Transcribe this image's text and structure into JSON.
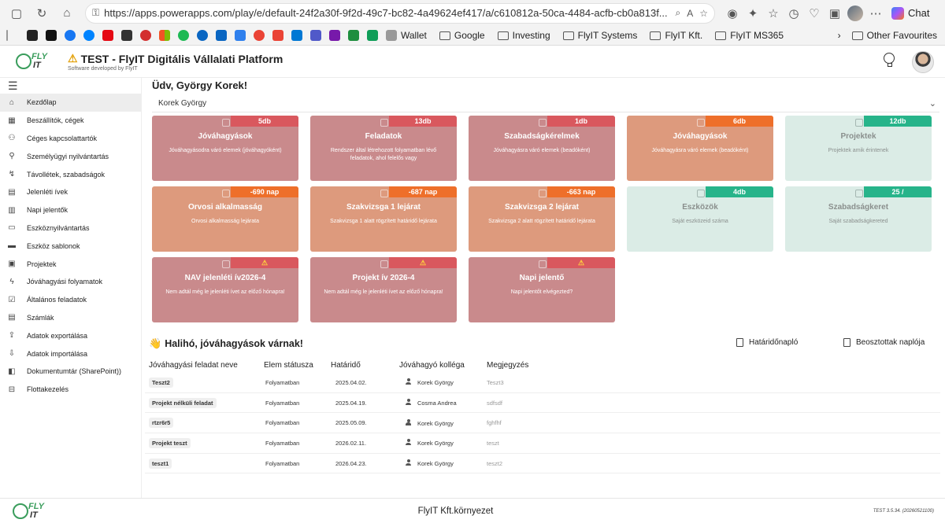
{
  "browser": {
    "url": "https://apps.powerapps.com/play/e/default-24f2a30f-9f2d-49c7-bc82-4a49624ef417/a/c610812a-50ca-4484-acfb-cb0a813f...",
    "chat_label": "Chat",
    "bookmarks": [
      "Wallet",
      "Google",
      "Investing",
      "FlyIT Systems",
      "FlyIT Kft.",
      "FlyIT MS365"
    ],
    "other_favourites": "Other Favourites"
  },
  "header": {
    "logo_top": "FLY",
    "logo_bottom": "IT",
    "title": "TEST - FlyIT Digitális Vállalati Platform",
    "subtitle": "Software developed by FlyIT"
  },
  "sidebar": {
    "items": [
      {
        "label": "Kezdőlap",
        "icon": "home-icon"
      },
      {
        "label": "Beszállítók, cégek",
        "icon": "building-icon"
      },
      {
        "label": "Céges kapcsolattartók",
        "icon": "contacts-icon"
      },
      {
        "label": "Személyügyi nyilvántartás",
        "icon": "person-icon"
      },
      {
        "label": "Távollétek, szabadságok",
        "icon": "route-icon"
      },
      {
        "label": "Jelenléti ívek",
        "icon": "attendance-icon"
      },
      {
        "label": "Napi jelentők",
        "icon": "report-icon"
      },
      {
        "label": "Eszköznyilvántartás",
        "icon": "asset-icon"
      },
      {
        "label": "Eszköz sablonok",
        "icon": "template-icon"
      },
      {
        "label": "Projektek",
        "icon": "project-icon"
      },
      {
        "label": "Jóváhagyási folyamatok",
        "icon": "flow-icon"
      },
      {
        "label": "Általános feladatok",
        "icon": "task-icon"
      },
      {
        "label": "Számlák",
        "icon": "invoice-icon"
      },
      {
        "label": "Adatok exportálása",
        "icon": "export-icon"
      },
      {
        "label": "Adatok importálása",
        "icon": "import-icon"
      },
      {
        "label": "Dokumentumtár (SharePoint))",
        "icon": "sharepoint-icon"
      },
      {
        "label": "Flottakezelés",
        "icon": "car-icon"
      }
    ]
  },
  "main": {
    "greeting": "Üdv, György Korek!",
    "selected_user": "Korek György",
    "tiles": [
      {
        "badge": "5db",
        "title": "Jóváhagyások",
        "desc": "Jóváhagyásodra váró elemek (jóváhagyóként)",
        "color": "red"
      },
      {
        "badge": "13db",
        "title": "Feladatok",
        "desc": "Rendszer által létrehozott folyamatban lévő feladatok, ahol felelős vagy",
        "color": "red"
      },
      {
        "badge": "1db",
        "title": "Szabadságkérelmek",
        "desc": "Jóváhagyásra váró elemek (beadóként)",
        "color": "red"
      },
      {
        "badge": "6db",
        "title": "Jóváhagyások",
        "desc": "Jóváhagyásra váró elemek (beadóként)",
        "color": "orange"
      },
      {
        "badge": "12db",
        "title": "Projektek",
        "desc": "Projektek amik érintenek",
        "color": "green"
      },
      {
        "badge": "-690 nap",
        "title": "Orvosi alkalmasság",
        "desc": "Orvosi alkalmasság lejárata",
        "color": "orange"
      },
      {
        "badge": "-687 nap",
        "title": "Szakvizsga 1 lejárat",
        "desc": "Szakvizsga 1 alatt rögzített határidő lejárata",
        "color": "orange"
      },
      {
        "badge": "-663 nap",
        "title": "Szakvizsga 2 lejárat",
        "desc": "Szakvizsga 2 alatt rögzített határidő lejárata",
        "color": "orange"
      },
      {
        "badge": "4db",
        "title": "Eszközök",
        "desc": "Saját eszközeid száma",
        "color": "green"
      },
      {
        "badge": "25 /",
        "title": "Szabadságkeret",
        "desc": "Saját szabadságkereted",
        "color": "green"
      },
      {
        "badge": "⚠",
        "title": "NAV jelenléti ív2026-4",
        "desc": "Nem adtál még le jelenléti ívet az előző hónapra!",
        "color": "red"
      },
      {
        "badge": "⚠",
        "title": "Projekt ív 2026-4",
        "desc": "Nem adtál még le jelenléti ívet az előző hónapra!",
        "color": "red"
      },
      {
        "badge": "⚠",
        "title": "Napi jelentő",
        "desc": "Napi jelentőt elvégezted?",
        "color": "red"
      }
    ],
    "approvals_title": "Halihó, jóváhagyások várnak!",
    "approvals_emoji": "👋",
    "deadline_log": "Határidőnapló",
    "subordinates_log": "Beosztottak naplója",
    "table": {
      "columns": [
        "Jóváhagyási feladat neve",
        "Elem státusza",
        "Határidő",
        "Jóváhagyó kolléga",
        "Megjegyzés"
      ],
      "rows": [
        {
          "name": "Teszt2",
          "status": "Folyamatban",
          "deadline": "2025.04.02.",
          "approver": "Korek György",
          "note": "Teszt3"
        },
        {
          "name": "Projekt nélküli feladat",
          "status": "Folyamatban",
          "deadline": "2025.04.19.",
          "approver": "Cosma Andrea",
          "note": "sdfsdf"
        },
        {
          "name": "rtzr6r5",
          "status": "Folyamatban",
          "deadline": "2025.05.09.",
          "approver": "Korek György",
          "note": "fghfhf"
        },
        {
          "name": "Projekt teszt",
          "status": "Folyamatban",
          "deadline": "2026.02.11.",
          "approver": "Korek György",
          "note": "teszt"
        },
        {
          "name": "teszt1",
          "status": "Folyamatban",
          "deadline": "2026.04.23.",
          "approver": "Korek György",
          "note": "teszt2"
        }
      ]
    }
  },
  "footer": {
    "environment": "FlyIT Kft.környezet",
    "version": "TEST 3.5.34. (20260521100)"
  }
}
